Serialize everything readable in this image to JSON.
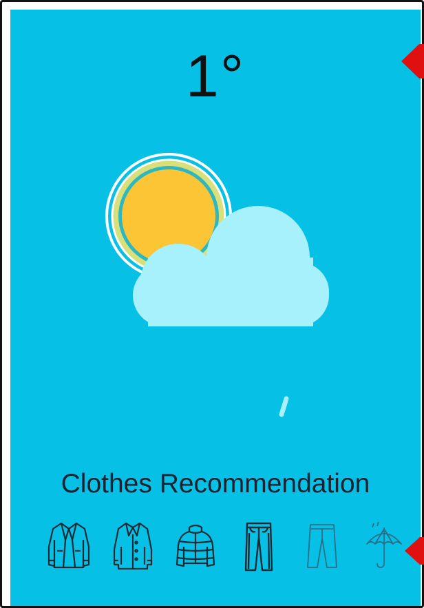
{
  "weather": {
    "temperature": "1°",
    "condition_icon": "partly-cloudy-sun-with-rain-icon"
  },
  "recommendation": {
    "title": "Clothes Recommendation",
    "items": [
      {
        "icon": "leather-jacket-icon",
        "state": "recommended"
      },
      {
        "icon": "coat-icon",
        "state": "recommended"
      },
      {
        "icon": "puffer-jacket-icon",
        "state": "recommended"
      },
      {
        "icon": "jeans-icon",
        "state": "recommended"
      },
      {
        "icon": "pants-icon",
        "state": "dimmed"
      },
      {
        "icon": "umbrella-icon",
        "state": "dimmed"
      }
    ]
  },
  "colors": {
    "background": "#06c0e6",
    "sun": "#fbc535",
    "cloud": "#a6f1fb",
    "icon_active": "#1a2a33",
    "icon_dimmed": "#2a6d86",
    "pointer": "#e01010"
  }
}
